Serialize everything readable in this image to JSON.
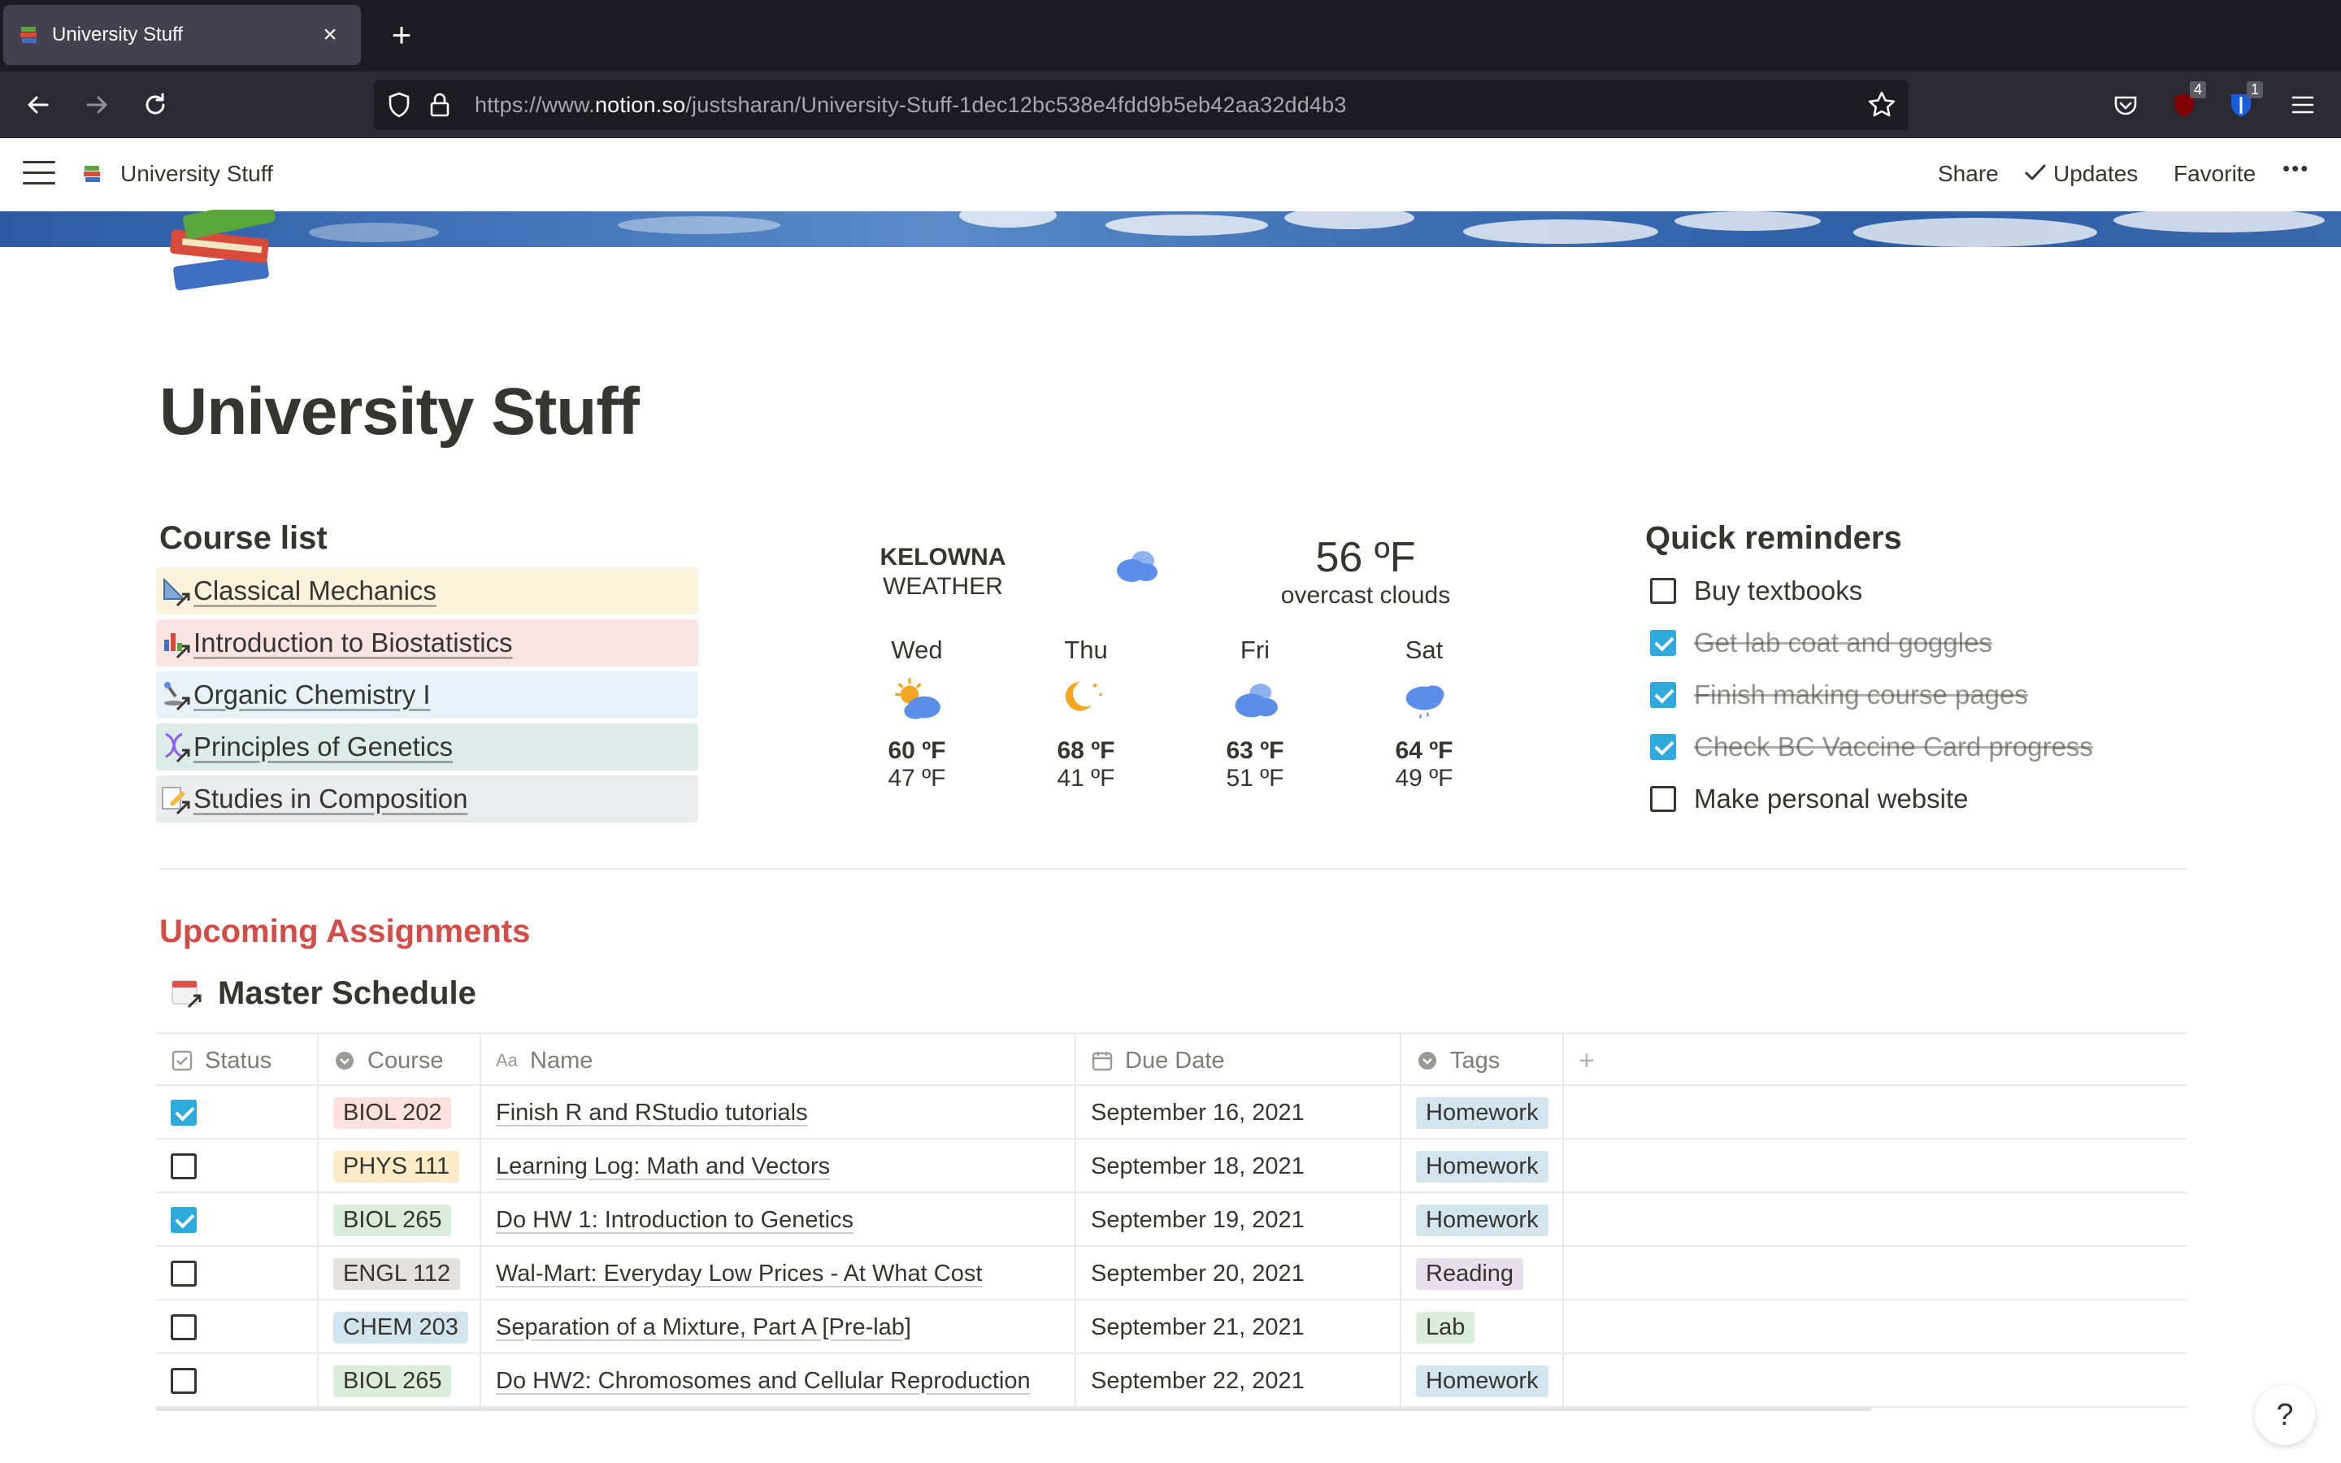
{
  "browser": {
    "tab_title": "University Stuff",
    "tab_close": "×",
    "new_tab": "+",
    "url_prefix": "https://www.",
    "url_domain": "notion.so",
    "url_path": "/justsharan/University-Stuff-1dec12bc538e4fdd9b5eb42aa32dd4b3",
    "ext_badge_1": "4",
    "ext_badge_2": "1"
  },
  "topbar": {
    "page_title": "University Stuff",
    "share": "Share",
    "updates": "Updates",
    "favorite": "Favorite",
    "more": "•••"
  },
  "page": {
    "title": "University Stuff"
  },
  "course_list": {
    "heading": "Course list",
    "items": [
      {
        "label": "Classical Mechanics",
        "color": "#fbf3db",
        "icon": "triangle-ruler-icon"
      },
      {
        "label": "Introduction to Biostatistics",
        "color": "#fbe4e4",
        "icon": "bar-chart-icon"
      },
      {
        "label": "Organic Chemistry I",
        "color": "#e7f3f8",
        "icon": "microscope-icon"
      },
      {
        "label": "Principles of Genetics",
        "color": "#ddedea",
        "icon": "dna-icon"
      },
      {
        "label": "Studies in Composition",
        "color": "#ebeced",
        "icon": "pencil-paper-icon"
      }
    ]
  },
  "weather": {
    "location_line1": "KELOWNA",
    "location_line2": "WEATHER",
    "current_temp": "56 ºF",
    "condition": "overcast clouds",
    "forecast": [
      {
        "day": "Wed",
        "hi": "60 ºF",
        "lo": "47 ºF",
        "icon": "sun-cloud-icon"
      },
      {
        "day": "Thu",
        "hi": "68 ºF",
        "lo": "41 ºF",
        "icon": "moon-icon"
      },
      {
        "day": "Fri",
        "hi": "63 ºF",
        "lo": "51 ºF",
        "icon": "clouds-icon"
      },
      {
        "day": "Sat",
        "hi": "64 ºF",
        "lo": "49 ºF",
        "icon": "rain-cloud-icon"
      }
    ]
  },
  "reminders": {
    "heading": "Quick reminders",
    "items": [
      {
        "label": "Buy textbooks",
        "checked": false
      },
      {
        "label": "Get lab coat and goggles",
        "checked": true
      },
      {
        "label": "Finish making course pages",
        "checked": true
      },
      {
        "label": "Check BC Vaccine Card progress",
        "checked": true
      },
      {
        "label": "Make personal website",
        "checked": false
      }
    ]
  },
  "assignments": {
    "heading": "Upcoming Assignments",
    "db_title": "Master Schedule",
    "columns": {
      "status": "Status",
      "course": "Course",
      "name": "Name",
      "due": "Due Date",
      "tags": "Tags",
      "add": "+"
    },
    "rows": [
      {
        "checked": true,
        "course": "BIOL 202",
        "course_color": "#ffe2dd",
        "name": "Finish R and RStudio tutorials",
        "due": "September 16, 2021",
        "tag": "Homework",
        "tag_color": "#d3e5ef"
      },
      {
        "checked": false,
        "course": "PHYS 111",
        "course_color": "#fdecc8",
        "name": "Learning Log: Math and Vectors",
        "due": "September 18, 2021",
        "tag": "Homework",
        "tag_color": "#d3e5ef"
      },
      {
        "checked": true,
        "course": "BIOL 265",
        "course_color": "#dbeddb",
        "name": "Do HW 1: Introduction to Genetics",
        "due": "September 19, 2021",
        "tag": "Homework",
        "tag_color": "#d3e5ef"
      },
      {
        "checked": false,
        "course": "ENGL 112",
        "course_color": "#e3e2e0",
        "name": "Wal-Mart: Everyday Low Prices - At What Cost",
        "due": "September 20, 2021",
        "tag": "Reading",
        "tag_color": "#e8deee"
      },
      {
        "checked": false,
        "course": "CHEM 203",
        "course_color": "#d3e5ef",
        "name": "Separation of a Mixture, Part A [Pre-lab]",
        "due": "September 21, 2021",
        "tag": "Lab",
        "tag_color": "#dbeddb"
      },
      {
        "checked": false,
        "course": "BIOL 265",
        "course_color": "#dbeddb",
        "name": "Do HW2: Chromosomes and Cellular Reproduction",
        "due": "September 22, 2021",
        "tag": "Homework",
        "tag_color": "#d3e5ef"
      }
    ]
  },
  "help": "?"
}
